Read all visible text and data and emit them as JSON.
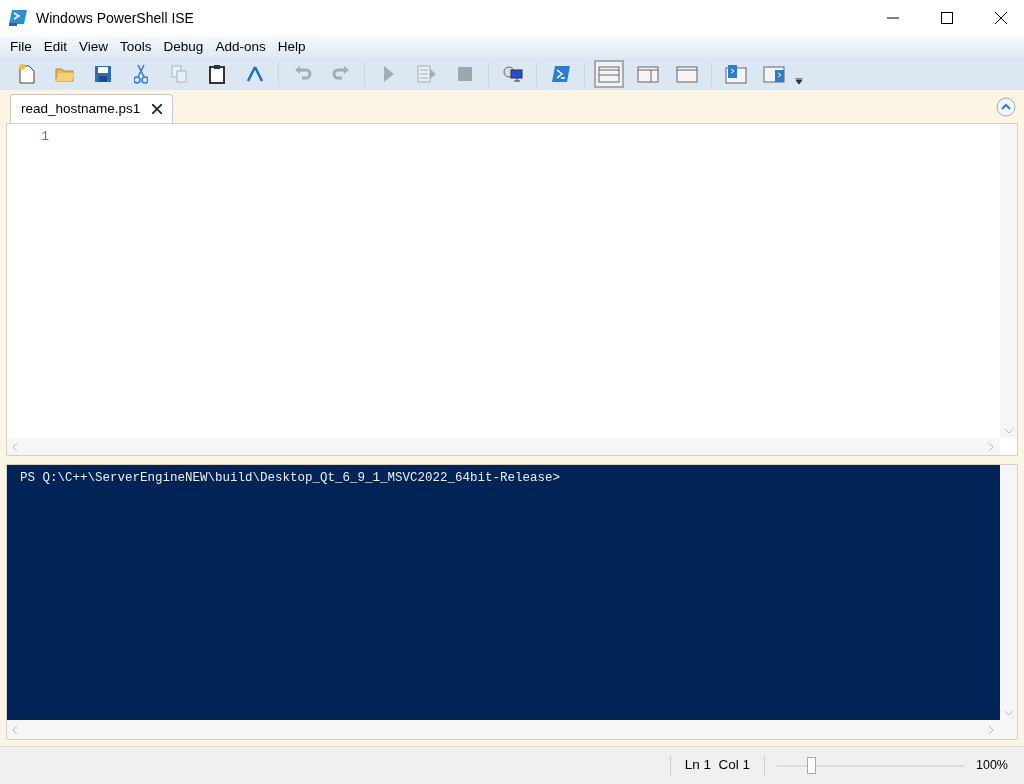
{
  "window": {
    "title": "Windows PowerShell ISE"
  },
  "menu": [
    "File",
    "Edit",
    "View",
    "Tools",
    "Debug",
    "Add-ons",
    "Help"
  ],
  "toolbar": {
    "groups": [
      [
        {
          "kind": "new",
          "disabled": false
        },
        {
          "kind": "open",
          "disabled": false
        },
        {
          "kind": "save",
          "disabled": false
        },
        {
          "kind": "cut",
          "disabled": false
        },
        {
          "kind": "copy",
          "disabled": true
        },
        {
          "kind": "paste",
          "disabled": false
        },
        {
          "kind": "clear",
          "disabled": false
        }
      ],
      [
        {
          "kind": "undo",
          "disabled": true
        },
        {
          "kind": "redo",
          "disabled": true
        }
      ],
      [
        {
          "kind": "run",
          "disabled": true
        },
        {
          "kind": "runsel",
          "disabled": true
        },
        {
          "kind": "stop",
          "disabled": true
        }
      ],
      [
        {
          "kind": "remote",
          "disabled": false
        }
      ],
      [
        {
          "kind": "shell",
          "disabled": false
        }
      ]
    ],
    "layout_buttons": [
      {
        "kind": "top",
        "selected": true
      },
      {
        "kind": "right",
        "selected": false
      },
      {
        "kind": "max",
        "selected": false
      }
    ],
    "pane_buttons": [
      {
        "kind": "script"
      },
      {
        "kind": "console"
      }
    ]
  },
  "tabs": [
    {
      "label": "read_hostname.ps1",
      "selected": true
    }
  ],
  "editor": {
    "line_numbers": [
      "1"
    ]
  },
  "console": {
    "prompt": "PS Q:\\C++\\ServerEngineNEW\\build\\Desktop_Qt_6_9_1_MSVC2022_64bit-Release>"
  },
  "status_bar": {
    "position": "Ln 1  Col 1",
    "zoom": {
      "level": 0.18,
      "reading": "100%"
    }
  }
}
